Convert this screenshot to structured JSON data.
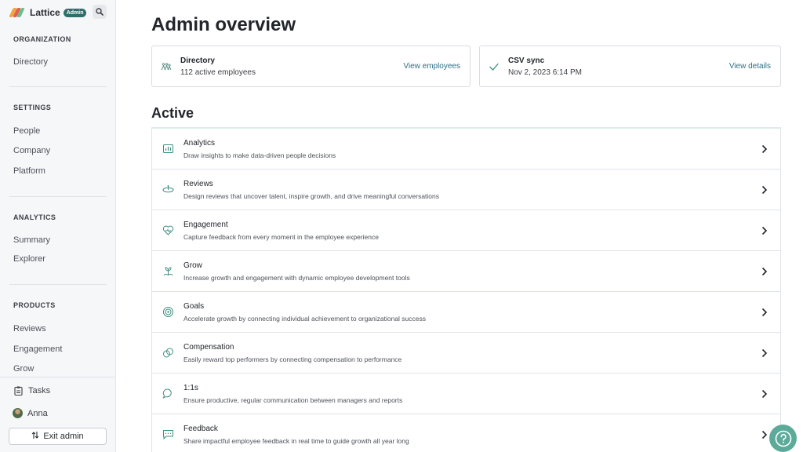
{
  "sidebar": {
    "brand_name": "Lattice",
    "brand_badge": "Admin",
    "sections": {
      "organization": {
        "heading": "ORGANIZATION",
        "items": [
          "Directory"
        ]
      },
      "settings": {
        "heading": "SETTINGS",
        "items": [
          "People",
          "Company",
          "Platform"
        ]
      },
      "analytics": {
        "heading": "ANALYTICS",
        "items": [
          "Summary",
          "Explorer"
        ]
      },
      "products": {
        "heading": "PRODUCTS",
        "items": [
          "Reviews",
          "Engagement",
          "Grow"
        ]
      }
    },
    "bottom": {
      "tasks": "Tasks",
      "user": "Anna",
      "exit_admin": "Exit admin"
    }
  },
  "main": {
    "title": "Admin overview",
    "cards": [
      {
        "title": "Directory",
        "subtitle": "112 active employees",
        "link": "View employees",
        "icon": "people-icon"
      },
      {
        "title": "CSV sync",
        "subtitle": "Nov 2, 2023 6:14 PM",
        "link": "View details",
        "icon": "check-icon"
      }
    ],
    "active_heading": "Active",
    "products": [
      {
        "title": "Analytics",
        "description": "Draw insights to make data-driven people decisions",
        "icon": "analytics-icon"
      },
      {
        "title": "Reviews",
        "description": "Design reviews that uncover talent, inspire growth, and drive meaningful conversations",
        "icon": "reviews-icon"
      },
      {
        "title": "Engagement",
        "description": "Capture feedback from every moment in the employee experience",
        "icon": "engagement-icon"
      },
      {
        "title": "Grow",
        "description": "Increase growth and engagement with dynamic employee development tools",
        "icon": "grow-icon"
      },
      {
        "title": "Goals",
        "description": "Accelerate growth by connecting individual achievement to organizational success",
        "icon": "goals-icon"
      },
      {
        "title": "Compensation",
        "description": "Easily reward top performers by connecting compensation to performance",
        "icon": "compensation-icon"
      },
      {
        "title": "1:1s",
        "description": "Ensure productive, regular communication between managers and reports",
        "icon": "one-on-one-icon"
      },
      {
        "title": "Feedback",
        "description": "Share impactful employee feedback in real time to guide growth all year long",
        "icon": "feedback-icon"
      }
    ]
  },
  "colors": {
    "accent": "#2f6f87",
    "brand_teal": "#2f6e6a",
    "help_button": "#5cab9a",
    "icon_teal": "#3f8f80"
  }
}
